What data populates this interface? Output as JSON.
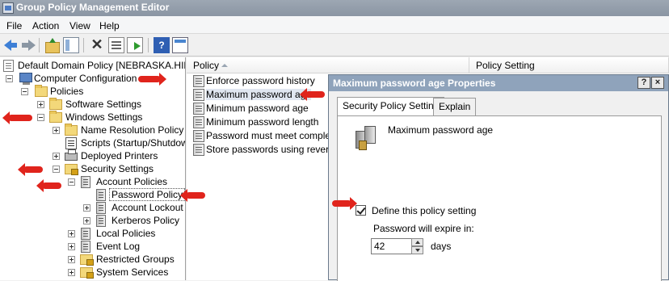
{
  "window": {
    "title": "Group Policy Management Editor"
  },
  "menu": {
    "items": [
      "File",
      "Action",
      "View",
      "Help"
    ]
  },
  "toolbar": {
    "help_label": "?"
  },
  "tree": {
    "items": [
      {
        "label": "Default Domain Policy [NEBRASKA.HILLTOP"
      },
      {
        "label": "Computer Configuration"
      },
      {
        "label": "Policies"
      },
      {
        "label": "Software Settings"
      },
      {
        "label": "Windows Settings"
      },
      {
        "label": "Name Resolution Policy"
      },
      {
        "label": "Scripts (Startup/Shutdown"
      },
      {
        "label": "Deployed Printers"
      },
      {
        "label": "Security Settings"
      },
      {
        "label": "Account Policies"
      },
      {
        "label": "Password Policy"
      },
      {
        "label": "Account Lockout P"
      },
      {
        "label": "Kerberos Policy"
      },
      {
        "label": "Local Policies"
      },
      {
        "label": "Event Log"
      },
      {
        "label": "Restricted Groups"
      },
      {
        "label": "System Services"
      }
    ]
  },
  "list": {
    "columns": [
      "Policy",
      "Policy Setting"
    ],
    "rows": [
      {
        "policy": "Enforce password history"
      },
      {
        "policy": "Maximum password age"
      },
      {
        "policy": "Minimum password age"
      },
      {
        "policy": "Minimum password length"
      },
      {
        "policy": "Password must meet complexity"
      },
      {
        "policy": "Store passwords using reversib"
      }
    ]
  },
  "dialog": {
    "title": "Maximum password age Properties",
    "help_button": "?",
    "close_button": "×",
    "tabs": [
      "Security Policy Setting",
      "Explain"
    ],
    "policy_name": "Maximum password age",
    "define_checkbox_label": "Define this policy setting",
    "define_checked": true,
    "expire_label": "Password will expire in:",
    "expire_value": "42",
    "unit_label": "days"
  },
  "colors": {
    "annotation_arrow": "#e0241c",
    "titlebar": "#8fa3bb"
  }
}
